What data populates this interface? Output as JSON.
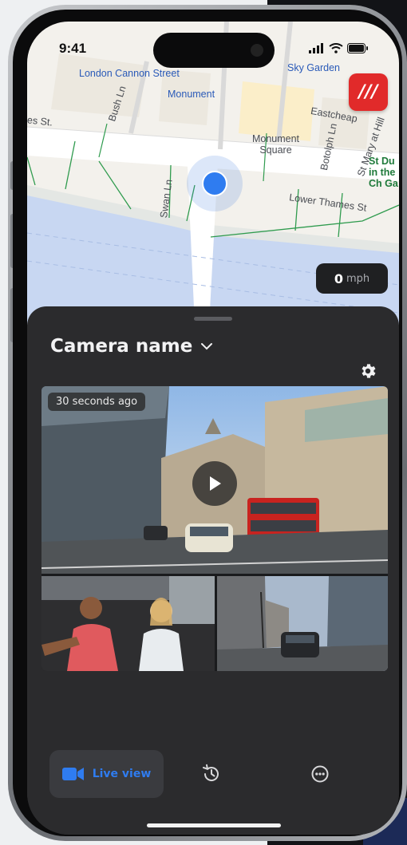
{
  "status_bar": {
    "time": "9:41"
  },
  "map": {
    "labels": {
      "london_cannon_street": "London Cannon Street",
      "monument": "Monument",
      "sky_garden": "Sky Garden",
      "bush_ln": "Bush Ln",
      "eastcheap": "Eastcheap",
      "monument_square": "Monument Square",
      "botolph_ln": "Botolph Ln",
      "st_mary_at_hill": "St Mary at Hill",
      "st_du": "St Du in the Ch Ga",
      "swan_ln": "Swan Ln",
      "lower_thames_st": "Lower Thames St",
      "es_st": "es St."
    },
    "speed": {
      "value": "0",
      "unit": "mph"
    },
    "app_badge": "///"
  },
  "sheet": {
    "camera_name": "Camera name",
    "live_view": {
      "timestamp": "30 seconds ago"
    }
  },
  "tabbar": {
    "live_view_label": "Live view"
  },
  "icons": {
    "camera": "video-camera-icon",
    "history": "history-icon",
    "more": "more-dots-icon",
    "settings": "gear-icon",
    "play": "play-icon"
  },
  "colors": {
    "accent": "#2f7cf0",
    "sheet_bg": "#2b2b2d",
    "badge_red": "#e12a2a",
    "map_water": "#c8d7f2"
  }
}
